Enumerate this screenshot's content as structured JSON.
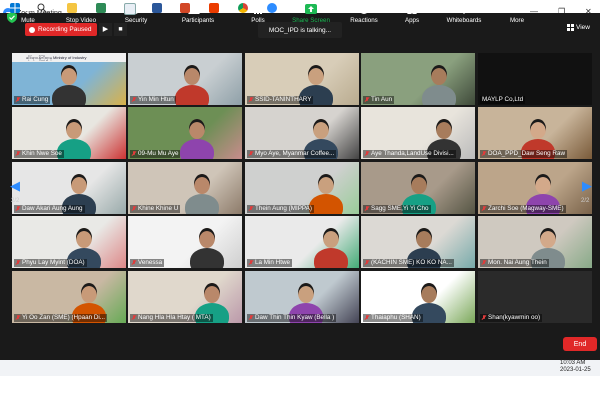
{
  "window": {
    "title": "Zoom Meeting",
    "min": "—",
    "restore": "❐",
    "close": "✕"
  },
  "topbar": {
    "recording_label": "Recording Paused",
    "play_icon": "▶",
    "stop_icon": "■",
    "talking": "MOC_IPD is talking...",
    "view_label": "View"
  },
  "pager": {
    "left": "2/2",
    "right": "2/2"
  },
  "participants": [
    "Rai Cung",
    "Yin Min Htun",
    "SSID-TANINTHARY",
    "Tin Aun",
    "MAYLP Co,Ltd",
    "Khin Nwe Soe",
    "09-Mu Mu Aye",
    "Myo Aye, Myanmar Coffee...",
    "Aye Thanda,LandUse Divisi...",
    "DOA_PPD_Daw Seng Raw",
    "Daw Akari Aung Aung",
    "Khine Khine U",
    "Thein Aung (MIPPA)",
    "Sagg SME,Yi Yi Cho",
    "Zarchi Soe (Magway-SME)",
    "Phyu Lay Myint (DOA)",
    "Venessa",
    "La Min Htwe",
    "(KACHIN SME) KO KO NA...",
    "Mon. Nai Aung Thein",
    "Yi Oo Zan (SME) (Hpaan Di...",
    "Nang Hla Hla Htay ( MTA)",
    "Daw Thin Thin Kyaw (Bella )",
    "Thaiaphu (SHAN)",
    "Shan(kyawmin oo)"
  ],
  "tile0_banner": "ဆိုင်ရာဝန်ကြီးဌာန Ministry of Industry",
  "toolbar": {
    "mute": "Mute",
    "stop_video": "Stop Video",
    "security": "Security",
    "participants": "Participants",
    "participants_count": "74",
    "polls": "Polls",
    "share_screen": "Share Screen",
    "reactions": "Reactions",
    "apps": "Apps",
    "whiteboards": "Whiteboards",
    "more": "More",
    "end": "End"
  },
  "clock": {
    "time": "10:03 AM",
    "date": "2023-01-25"
  },
  "colors": {
    "record_red": "#e02828",
    "zoom_blue": "#2d8cff",
    "share_green": "#1db954",
    "end_red": "#e02828"
  }
}
